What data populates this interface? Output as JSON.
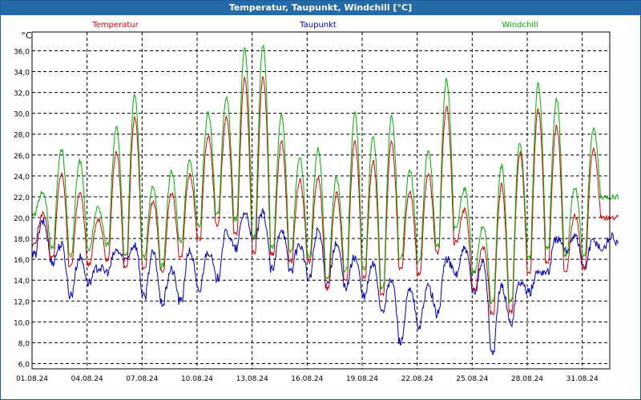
{
  "window": {
    "title": "Temperatur, Taupunkt, Windchill [°C]"
  },
  "chart_data": {
    "type": "line",
    "title": "Temperatur, Taupunkt, Windchill [°C]",
    "ylabel": "°C",
    "xlabel": "",
    "ylim": [
      5.5,
      37.8
    ],
    "xlim": [
      1,
      32.5
    ],
    "yticks": [
      "6,0",
      "8,0",
      "10,0",
      "12,0",
      "14,0",
      "16,0",
      "18,0",
      "20,0",
      "22,0",
      "24,0",
      "26,0",
      "28,0",
      "30,0",
      "32,0",
      "34,0",
      "36,0"
    ],
    "xticks": [
      "01.08.24",
      "04.08.24",
      "07.08.24",
      "10.08.24",
      "13.08.24",
      "16.08.24",
      "19.08.24",
      "22.08.24",
      "25.08.24",
      "28.08.24",
      "31.08.24"
    ],
    "grid": true,
    "legend_position": "top",
    "series": [
      {
        "name": "Temperatur",
        "color": "#e00000",
        "min": [
          17.4,
          16.2,
          15.4,
          15.6,
          16.0,
          15.2,
          15.3,
          14.8,
          16.4,
          18.0,
          19.4,
          18.4,
          16.6,
          16.5,
          15.8,
          15.8,
          13.2,
          14.0,
          14.4,
          12.6,
          15.0,
          14.6,
          16.6,
          17.6,
          13.0,
          10.8,
          11.0,
          14.8,
          15.8,
          15.0,
          15.2,
          20.0
        ],
        "max": [
          20.4,
          24.2,
          22.4,
          19.8,
          26.3,
          29.6,
          21.6,
          22.4,
          24.0,
          27.8,
          29.5,
          33.4,
          33.4,
          27.2,
          23.6,
          23.8,
          22.3,
          27.4,
          25.4,
          27.2,
          22.5,
          24.2,
          30.6,
          20.8,
          17.2,
          23.2,
          26.2,
          30.4,
          28.8,
          20.2,
          26.6,
          20.0
        ]
      },
      {
        "name": "Taupunkt",
        "color": "#0000c0",
        "min": [
          16.4,
          15.8,
          12.6,
          13.8,
          14.8,
          16.0,
          12.4,
          11.8,
          12.0,
          13.0,
          14.2,
          17.0,
          17.8,
          15.0,
          15.0,
          14.2,
          13.8,
          13.4,
          12.4,
          11.2,
          8.2,
          9.6,
          10.8,
          14.6,
          12.8,
          7.2,
          10.0,
          12.8,
          14.8,
          16.8,
          15.2,
          17.0
        ],
        "max": [
          19.6,
          17.4,
          16.2,
          15.2,
          16.8,
          17.4,
          16.6,
          15.0,
          16.8,
          16.8,
          18.6,
          20.5,
          20.4,
          19.0,
          17.4,
          18.8,
          17.4,
          16.2,
          15.5,
          14.0,
          13.0,
          13.4,
          16.0,
          17.0,
          15.8,
          13.4,
          13.8,
          14.8,
          18.0,
          18.4,
          17.8,
          18.2
        ]
      },
      {
        "name": "Windchill",
        "color": "#00b000",
        "min": [
          20.4,
          17.2,
          16.4,
          17.0,
          17.4,
          16.4,
          16.2,
          15.4,
          17.6,
          19.2,
          20.4,
          19.8,
          18.2,
          17.2,
          16.8,
          16.4,
          14.2,
          15.0,
          15.2,
          13.4,
          16.2,
          15.8,
          17.4,
          19.0,
          14.8,
          12.0,
          12.0,
          16.2,
          17.2,
          16.4,
          16.4,
          22.0
        ],
        "max": [
          22.4,
          26.6,
          25.4,
          21.0,
          28.6,
          31.8,
          23.0,
          24.4,
          25.4,
          30.0,
          31.5,
          36.2,
          36.6,
          29.8,
          25.8,
          26.6,
          23.8,
          30.0,
          27.8,
          29.8,
          24.6,
          26.4,
          33.2,
          22.8,
          19.2,
          25.0,
          27.2,
          32.8,
          31.4,
          22.8,
          28.6,
          22.0
        ]
      }
    ]
  }
}
